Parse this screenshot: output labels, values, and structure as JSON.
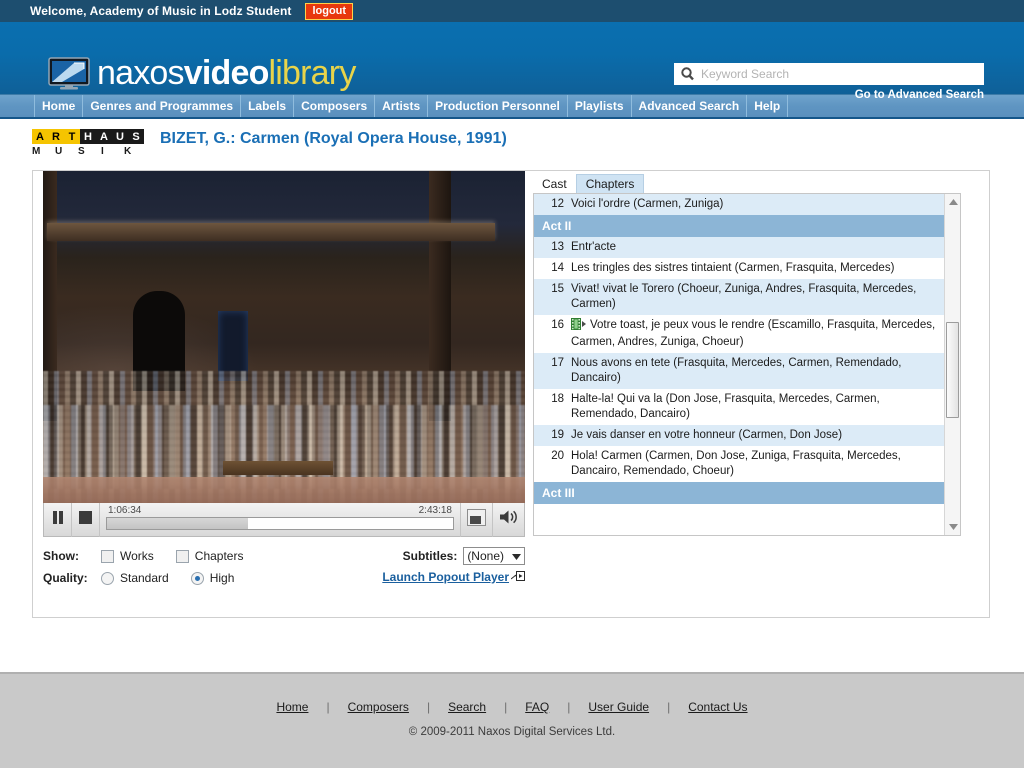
{
  "topbar": {
    "welcome": "Welcome, Academy of Music in Lodz Student",
    "logout_label": "logout"
  },
  "brand": {
    "name_part1": "naxos",
    "name_part2": "video",
    "name_part3": "library",
    "monitor_icon": "monitor-icon"
  },
  "search": {
    "placeholder": "Keyword Search",
    "value": "",
    "icon": "search-icon",
    "advanced_link": "Go to Advanced Search"
  },
  "nav": {
    "items": [
      {
        "label": "Home"
      },
      {
        "label": "Genres and Programmes"
      },
      {
        "label": "Labels"
      },
      {
        "label": "Composers"
      },
      {
        "label": "Artists"
      },
      {
        "label": "Production Personnel"
      },
      {
        "label": "Playlists"
      },
      {
        "label": "Advanced Search"
      },
      {
        "label": "Help"
      }
    ]
  },
  "label_logo": {
    "blocks": [
      "A",
      "R",
      "T",
      "H",
      "A",
      "U",
      "S"
    ],
    "subtitle": [
      "M",
      "U",
      "S",
      "I",
      "K"
    ],
    "accent_yellow": "#f5c400",
    "accent_black": "#1a1a1a"
  },
  "page": {
    "title": "BIZET, G.: Carmen (Royal Opera House, 1991)",
    "title_color": "#1a6fb5"
  },
  "player": {
    "pause_icon": "pause-icon",
    "stop_icon": "stop-icon",
    "fullscreen_icon": "fullscreen-icon",
    "volume_icon": "volume-icon",
    "current_time": "1:06:34",
    "total_time": "2:43:18",
    "progress_percent": 40.7
  },
  "options": {
    "show_label": "Show:",
    "works_label": "Works",
    "works_checked": false,
    "chapters_label": "Chapters",
    "chapters_checked": false,
    "quality_label": "Quality:",
    "standard_label": "Standard",
    "standard_selected": false,
    "high_label": "High",
    "high_selected": true,
    "subtitles_label": "Subtitles:",
    "subtitles_value": "(None)",
    "popout_label": "Launch Popout Player",
    "popout_icon": "popout-icon"
  },
  "list_panel": {
    "tabs": [
      {
        "label": "Cast",
        "active": false
      },
      {
        "label": "Chapters",
        "active": true
      }
    ],
    "rows": [
      {
        "kind": "chapter",
        "num": "12",
        "title": "Voici l'ordre (Carmen, Zuniga)",
        "shade": "alt",
        "icon": null
      },
      {
        "kind": "act",
        "title": "Act II"
      },
      {
        "kind": "chapter",
        "num": "13",
        "title": "Entr'acte",
        "shade": "alt",
        "icon": null
      },
      {
        "kind": "chapter",
        "num": "14",
        "title": "Les tringles des sistres tintaient (Carmen, Frasquita, Mercedes)",
        "shade": "plain",
        "icon": null
      },
      {
        "kind": "chapter",
        "num": "15",
        "title": "Vivat! vivat le Torero (Choeur, Zuniga, Andres, Frasquita, Mercedes, Carmen)",
        "shade": "alt",
        "icon": null
      },
      {
        "kind": "chapter",
        "num": "16",
        "title": "Votre toast, je peux vous le rendre (Escamillo, Frasquita, Mercedes, Carmen, Andres, Zuniga, Choeur)",
        "shade": "plain",
        "icon": "film-play-icon"
      },
      {
        "kind": "chapter",
        "num": "17",
        "title": "Nous avons en tete (Frasquita, Mercedes, Carmen, Remendado, Dancairo)",
        "shade": "alt",
        "icon": null
      },
      {
        "kind": "chapter",
        "num": "18",
        "title": "Halte-la! Qui va la (Don Jose, Frasquita, Mercedes, Carmen, Remendado, Dancairo)",
        "shade": "plain",
        "icon": null
      },
      {
        "kind": "chapter",
        "num": "19",
        "title": "Je vais danser en votre honneur (Carmen, Don Jose)",
        "shade": "alt",
        "icon": null
      },
      {
        "kind": "chapter",
        "num": "20",
        "title": "Hola! Carmen (Carmen, Don Jose, Zuniga, Frasquita, Mercedes, Dancairo, Remendado, Choeur)",
        "shade": "plain",
        "icon": null
      },
      {
        "kind": "act",
        "title": "Act III"
      }
    ],
    "scrollbar": {
      "up_icon": "scroll-up-icon",
      "down_icon": "scroll-down-icon",
      "thumb": "scroll-thumb"
    }
  },
  "footer": {
    "links": [
      "Home",
      "Composers",
      "Search",
      "FAQ",
      "User Guide",
      "Contact Us"
    ],
    "separator": "|",
    "copyright": "© 2009-2011 Naxos Digital Services Ltd."
  }
}
